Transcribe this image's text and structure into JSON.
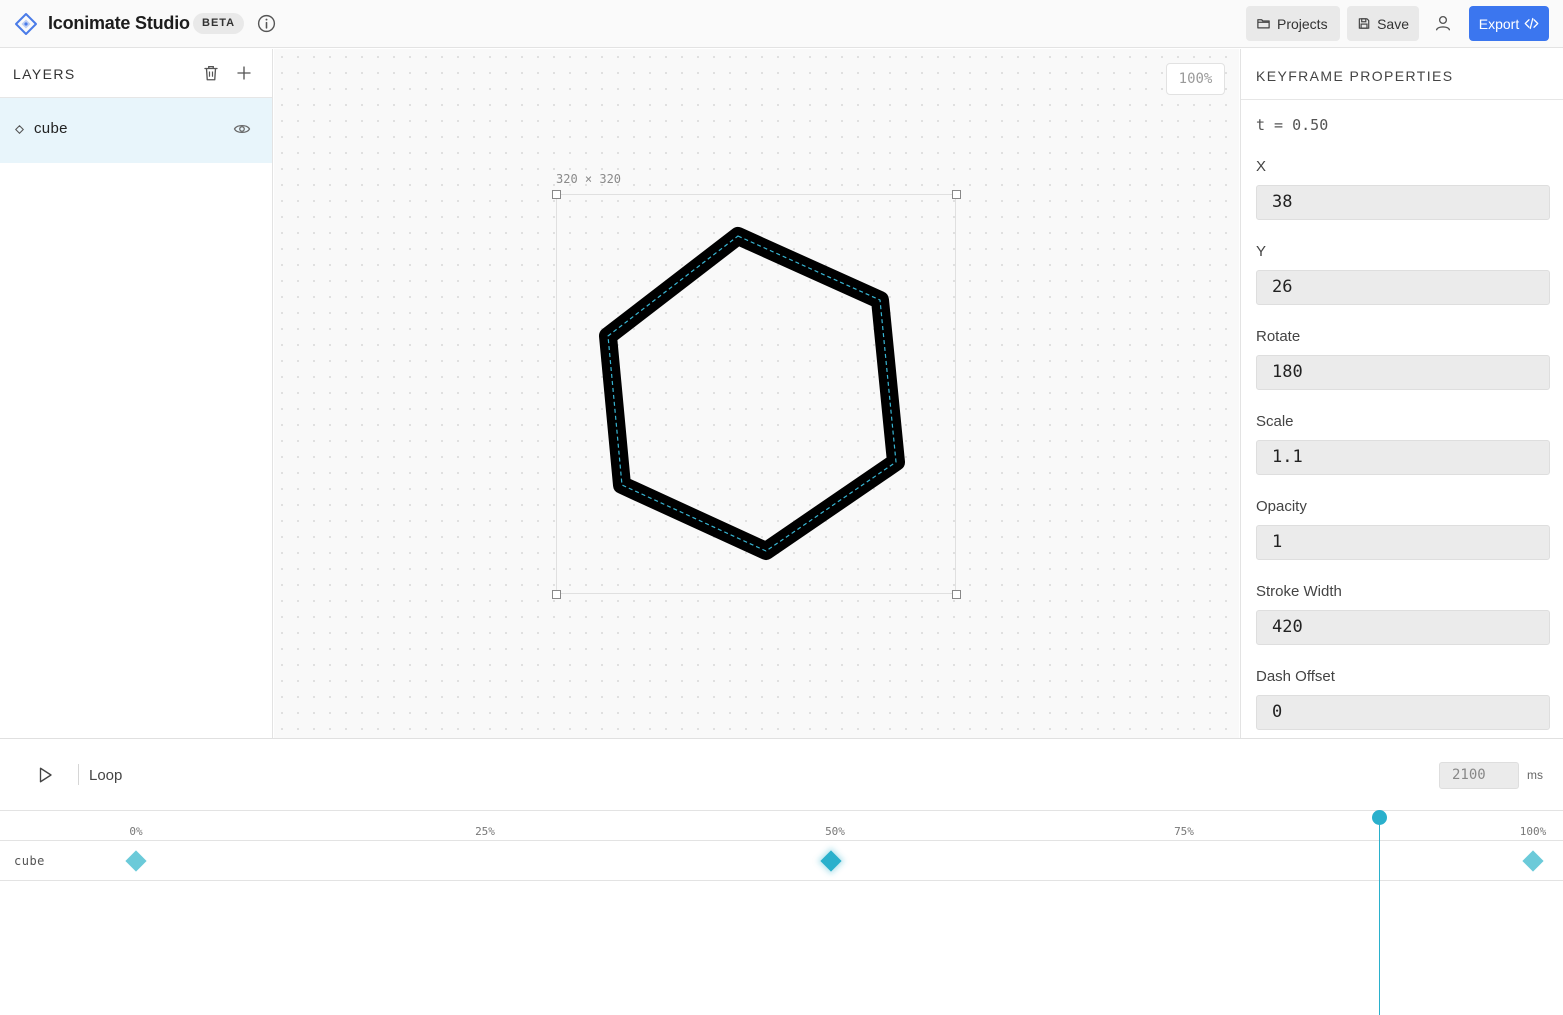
{
  "app": {
    "title": "Iconimate Studio",
    "badge": "BETA",
    "accent": "#3b76ef"
  },
  "toolbar": {
    "projects_label": "Projects",
    "save_label": "Save",
    "export_label": "Export",
    "icons": [
      "logo-diamond-icon",
      "info-icon",
      "folder-icon",
      "save-icon",
      "user-icon",
      "code-icon"
    ]
  },
  "layers": {
    "title": "LAYERS",
    "items": [
      {
        "name": "cube",
        "selected": true
      }
    ]
  },
  "canvas": {
    "zoom": "100%",
    "artboard_size": "320 × 320"
  },
  "properties": {
    "title": "KEYFRAME PROPERTIES",
    "t": "t = 0.50",
    "fields": [
      {
        "label": "X",
        "value": "38"
      },
      {
        "label": "Y",
        "value": "26"
      },
      {
        "label": "Rotate",
        "value": "180"
      },
      {
        "label": "Scale",
        "value": "1.1"
      },
      {
        "label": "Opacity",
        "value": "1"
      },
      {
        "label": "Stroke Width",
        "value": "420"
      },
      {
        "label": "Dash Offset",
        "value": "0"
      }
    ]
  },
  "timeline": {
    "loop_label": "Loop",
    "duration": "2100",
    "duration_unit": "ms",
    "ticks": [
      "0%",
      "25%",
      "50%",
      "75%",
      "100%"
    ],
    "track_name": "cube",
    "keyframes_percent": [
      0,
      50,
      100
    ],
    "active_keyframe_percent": 50,
    "playhead_percent": 89,
    "playhead_color": "#2ab0cc"
  }
}
